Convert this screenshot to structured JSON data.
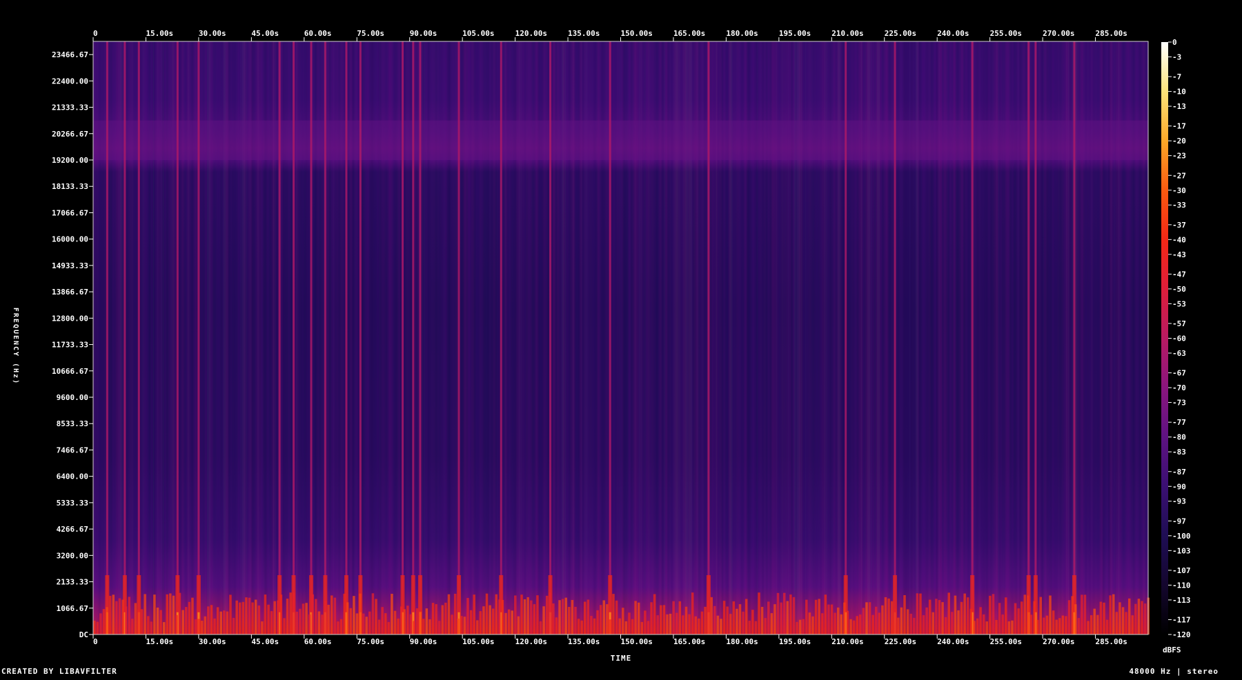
{
  "chart_data": {
    "type": "heatmap",
    "title": "",
    "xlabel": "TIME",
    "ylabel": "FREQUENCY (Hz)",
    "x_ticks": [
      "0",
      "15.00s",
      "30.00s",
      "45.00s",
      "60.00s",
      "75.00s",
      "90.00s",
      "105.00s",
      "120.00s",
      "135.00s",
      "150.00s",
      "165.00s",
      "180.00s",
      "195.00s",
      "210.00s",
      "225.00s",
      "240.00s",
      "255.00s",
      "270.00s",
      "285.00s"
    ],
    "x_tick_seconds": [
      0,
      15,
      30,
      45,
      60,
      75,
      90,
      105,
      120,
      135,
      150,
      165,
      180,
      195,
      210,
      225,
      240,
      255,
      270,
      285
    ],
    "xlim": [
      0,
      300
    ],
    "y_ticks": [
      "23466.67",
      "22400.00",
      "21333.33",
      "20266.67",
      "19200.00",
      "18133.33",
      "17066.67",
      "16000.00",
      "14933.33",
      "13866.67",
      "12800.00",
      "11733.33",
      "10666.67",
      "9600.00",
      "8533.33",
      "7466.67",
      "6400.00",
      "5333.33",
      "4266.67",
      "3200.00",
      "2133.33",
      "1066.67",
      "DC"
    ],
    "y_tick_values": [
      23466.67,
      22400,
      21333.33,
      20266.67,
      19200,
      18133.33,
      17066.67,
      16000,
      14933.33,
      13866.67,
      12800,
      11733.33,
      10666.67,
      9600,
      8533.33,
      7466.67,
      6400,
      5333.33,
      4266.67,
      3200,
      2133.33,
      1066.67,
      0
    ],
    "ylim": [
      0,
      24000
    ],
    "colorbar": {
      "label": "dBFS",
      "ticks": [
        "0",
        "-3",
        "-7",
        "-10",
        "-13",
        "-17",
        "-20",
        "-23",
        "-27",
        "-30",
        "-33",
        "-37",
        "-40",
        "-43",
        "-47",
        "-50",
        "-53",
        "-57",
        "-60",
        "-63",
        "-67",
        "-70",
        "-73",
        "-77",
        "-80",
        "-83",
        "-87",
        "-90",
        "-93",
        "-97",
        "-100",
        "-103",
        "-107",
        "-110",
        "-113",
        "-117",
        "-120"
      ],
      "range": [
        -120,
        0
      ],
      "colors": [
        "#000000",
        "#14062e",
        "#1e0d54",
        "#3a0f72",
        "#5e1282",
        "#8a157e",
        "#b81a62",
        "#de1e3a",
        "#f22816",
        "#fb5a10",
        "#fda828",
        "#fee47a",
        "#ffffff"
      ]
    },
    "background_dbfs": -100,
    "loud_band_hz": [
      19200,
      20800
    ],
    "bright_transient_seconds": [
      4,
      9,
      13,
      24,
      30,
      53,
      57,
      62,
      66,
      72,
      76,
      88,
      91,
      93,
      104,
      116,
      130,
      147,
      175,
      214,
      228,
      250,
      266,
      268,
      279
    ]
  },
  "footer": {
    "left": "CREATED BY LIBAVFILTER",
    "right": "48000 Hz | stereo"
  },
  "colors": {
    "background": "#000000",
    "text": "#ffffff"
  }
}
